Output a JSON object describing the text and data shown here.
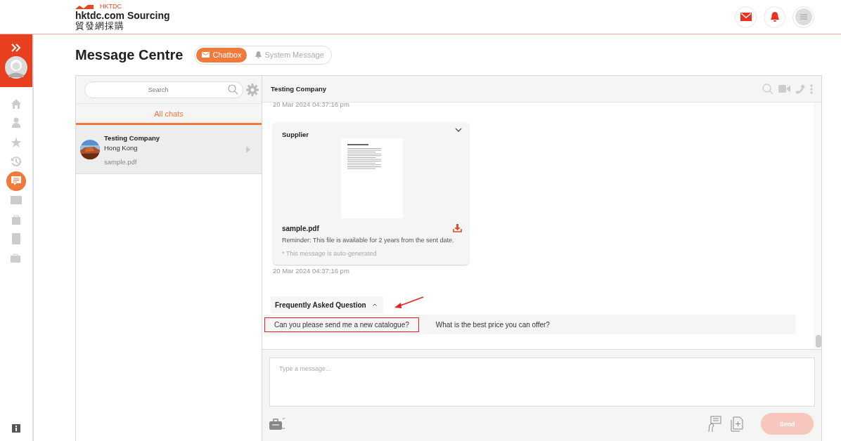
{
  "header": {
    "brand_small": "HKTDC",
    "brand": "hktdc.com Sourcing",
    "brand_chinese": "貿發網採購"
  },
  "nav": [
    {
      "selected": false
    },
    {
      "selected": false
    },
    {
      "selected": false
    },
    {
      "selected": false
    },
    {
      "selected": true
    },
    {
      "selected": false
    },
    {
      "selected": false
    },
    {
      "selected": false
    },
    {
      "selected": false
    }
  ],
  "page_title": "Message Centre",
  "tabs": [
    {
      "label": "Chatbox",
      "selected": true
    },
    {
      "label": "System Message",
      "selected": false
    }
  ],
  "search": {
    "placeholder": "Search"
  },
  "chat_filter": {
    "label": "All chats",
    "selected": true
  },
  "chats": [
    {
      "name": "Testing Company",
      "location": "Hong Kong",
      "preview": "sample.pdf",
      "selected": true
    }
  ],
  "conversation": {
    "title": "Testing Company",
    "messages": [
      {
        "kind": "timestamp",
        "text": "20 Mar 2024 04:37:16 pm"
      },
      {
        "kind": "file",
        "sender": "Supplier",
        "file_name": "sample.pdf",
        "reminder": "Reminder: This file is available for 2 years from the sent date.",
        "note": "* This message is auto-generated"
      },
      {
        "kind": "timestamp",
        "text": "20 Mar 2024 04:37:16 pm"
      }
    ],
    "faq": {
      "title": "Frequently Asked Question",
      "expanded": true,
      "annotated": true,
      "questions": [
        {
          "text": "Can you please send me a new catalogue?",
          "annotated": true
        },
        {
          "text": "What is the best price you can offer?",
          "annotated": false
        }
      ]
    },
    "composer": {
      "placeholder": "Type a message...",
      "send": "Send",
      "send_disabled": true
    }
  }
}
